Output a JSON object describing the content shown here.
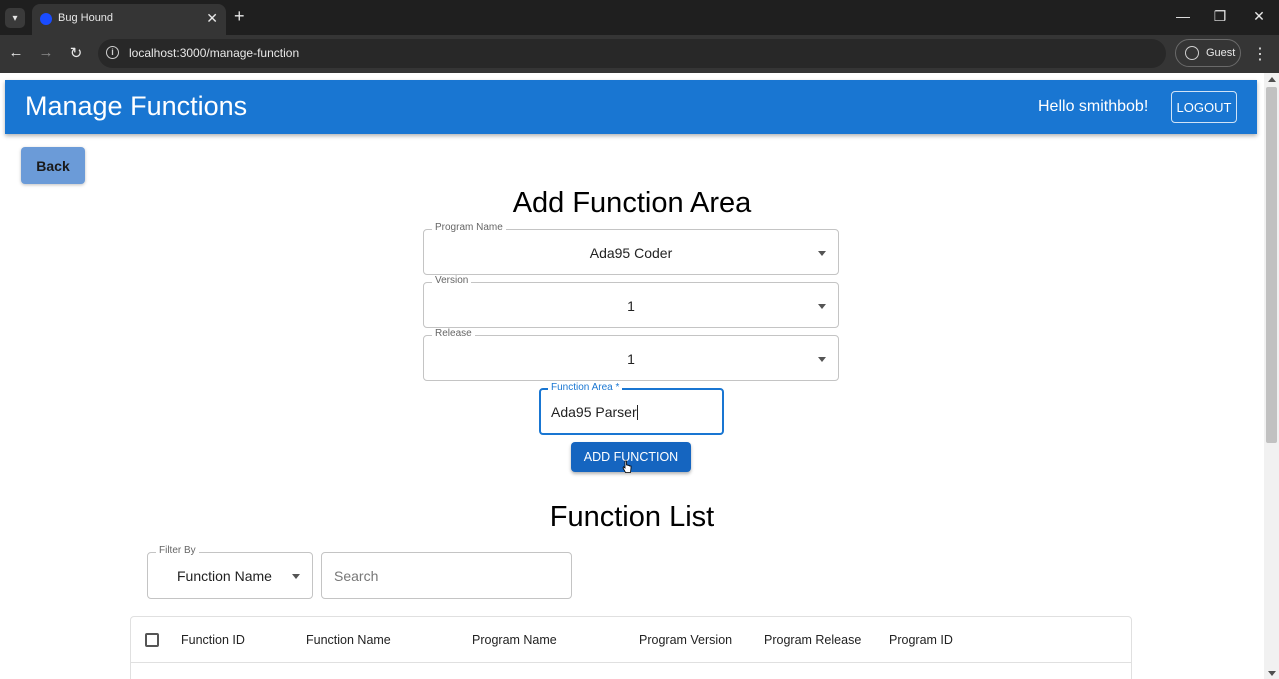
{
  "browser": {
    "tab_title": "Bug Hound",
    "url": "localhost:3000/manage-function",
    "profile_label": "Guest"
  },
  "header": {
    "title": "Manage Functions",
    "greeting": "Hello smithbob!",
    "logout_label": "LOGOUT",
    "color": "#1976d2"
  },
  "back_label": "Back",
  "add_section": {
    "heading": "Add Function Area",
    "program_name": {
      "label": "Program Name",
      "value": "Ada95 Coder"
    },
    "version": {
      "label": "Version",
      "value": "1"
    },
    "release": {
      "label": "Release",
      "value": "1"
    },
    "function_area": {
      "label": "Function Area *",
      "value": "Ada95 Parser"
    },
    "add_button_label": "ADD FUNCTION"
  },
  "list_section": {
    "heading": "Function List",
    "filter": {
      "label": "Filter By",
      "value": "Function Name"
    },
    "search_placeholder": "Search",
    "columns": [
      "Function ID",
      "Function Name",
      "Program Name",
      "Program Version",
      "Program Release",
      "Program ID"
    ]
  }
}
